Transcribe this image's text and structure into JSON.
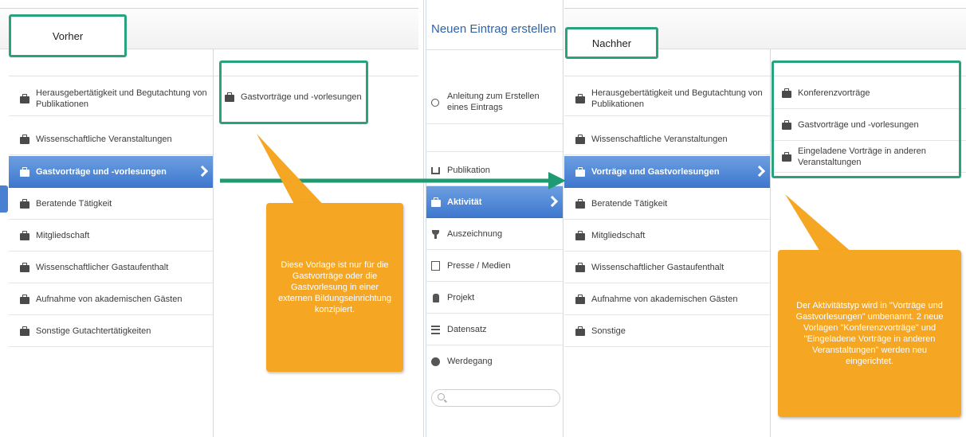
{
  "before": {
    "label": "Vorher",
    "menu": [
      "Herausgebertätigkeit und Begutachtung von Publikationen",
      "Wissenschaftliche Veranstaltungen",
      "Gastvorträge und -vorlesungen",
      "Beratende Tätigkeit",
      "Mitgliedschaft",
      "Wissenschaftlicher Gastaufenthalt",
      "Aufnahme von akademischen Gästen",
      "Sonstige Gutachtertätigkeiten"
    ],
    "active_index": 2,
    "templates": [
      "Gastvorträge und -vorlesungen"
    ],
    "callout": "Diese Vorlage ist nur für die Gastvorträge oder die Gastvorlesung in einer externen Bildungseinrichtung konzipiert."
  },
  "center": {
    "title": "Neuen Eintrag erstellen",
    "guide": "Anleitung zum Erstellen eines Eintrags",
    "menu": [
      "Publikation",
      "Aktivität",
      "Auszeichnung",
      "Presse / Medien",
      "Projekt",
      "Datensatz",
      "Werdegang"
    ],
    "icons": [
      "book-icon",
      "briefcase-icon",
      "trophy-icon",
      "newspaper-icon",
      "flask-icon",
      "database-icon",
      "globe-icon"
    ],
    "active_index": 1,
    "search_placeholder": ""
  },
  "after": {
    "label": "Nachher",
    "menu": [
      "Herausgebertätigkeit und Begutachtung von Publikationen",
      "Wissenschaftliche Veranstaltungen",
      "Vorträge und Gastvorlesungen",
      "Beratende Tätigkeit",
      "Mitgliedschaft",
      "Wissenschaftlicher Gastaufenthalt",
      "Aufnahme von akademischen Gästen",
      "Sonstige"
    ],
    "active_index": 2,
    "templates": [
      "Konferenzvorträge",
      "Gastvorträge und -vorlesungen",
      "Eingeladene Vorträge in anderen Veranstaltungen"
    ],
    "callout": "Der Aktivitätstyp wird in \"Vorträge und Gastvorlesungen\" umbenannt. 2 neue Vorlagen \"Konferenzvorträge\" und \"Eingeladene Vorträge in anderen Veranstaltungen\" werden neu eingerichtet."
  },
  "colors": {
    "accent_blue": "#3e78cf",
    "annotation_green": "#29a37e",
    "callout_orange": "#f5a623",
    "title_blue": "#2e63a8"
  }
}
